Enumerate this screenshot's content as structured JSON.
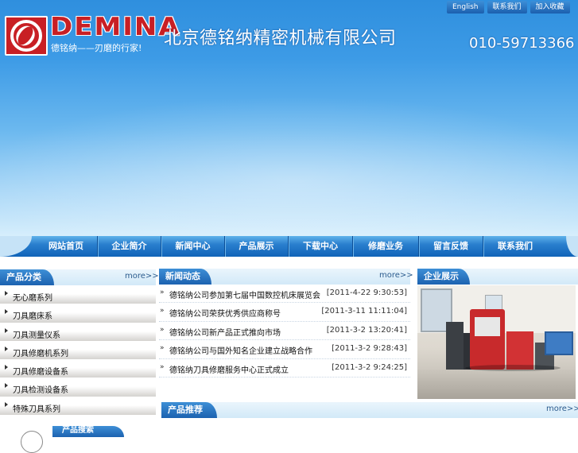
{
  "header": {
    "logo_text": "DEMINA",
    "logo_slogan": "德铭纳——刃磨的行家!",
    "company_name": "北京德铭纳精密机械有限公司",
    "phone": "010-59713366",
    "top_links": [
      "English",
      "联系我们",
      "加入收藏"
    ]
  },
  "nav": {
    "items": [
      "网站首页",
      "企业简介",
      "新闻中心",
      "产品展示",
      "下载中心",
      "修磨业务",
      "留言反馈",
      "联系我们"
    ]
  },
  "categories": {
    "title": "产品分类",
    "more": "more>>",
    "items": [
      "无心磨系列",
      "刀具磨床系",
      "刀具测量仪系",
      "刀具修磨机系列",
      "刀具修磨设备系",
      "刀具检测设备系",
      "特殊刀具系列"
    ]
  },
  "news": {
    "title": "新闻动态",
    "more": "more>>",
    "items": [
      {
        "title": "德铭纳公司参加第七届中国数控机床展览会",
        "date": "[2011-4-22 9:30:53]"
      },
      {
        "title": "德铭纳公司荣获优秀供应商称号",
        "date": "[2011-3-11 11:11:04]"
      },
      {
        "title": "德铭纳公司新产品正式推向市场",
        "date": "[2011-3-2 13:20:41]"
      },
      {
        "title": "德铭纳公司与国外知名企业建立战略合作",
        "date": "[2011-3-2 9:28:43]"
      },
      {
        "title": "德铭纳刀具修磨服务中心正式成立",
        "date": "[2011-3-2 9:24:25]"
      }
    ]
  },
  "showcase": {
    "title": "企业展示"
  },
  "recommend": {
    "title": "产品推荐",
    "more": "more>>"
  },
  "search": {
    "title": "产品搜索"
  }
}
